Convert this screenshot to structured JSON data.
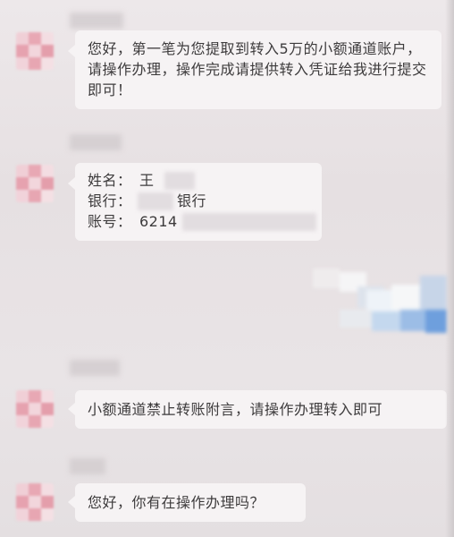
{
  "chat": {
    "messages": [
      {
        "text": "您好，第一笔为您提取到转入5万的小额通道账户，请操作办理，操作完成请提供转入凭证给我进行提交即可！"
      },
      {
        "account": {
          "name_label": "姓名：",
          "name_value": "王",
          "bank_label": "银行：",
          "bank_value": "银行",
          "number_label": "账号：",
          "number_value": "6214"
        }
      },
      {
        "text": "小额通道禁止转账附言，请操作办理转入即可"
      },
      {
        "text": "您好，你有在操作办理吗？"
      }
    ]
  },
  "colors": {
    "avatar_pink": "#e39aa8",
    "bubble_bg": "#f6f3f4",
    "background": "#e7e1e3"
  }
}
